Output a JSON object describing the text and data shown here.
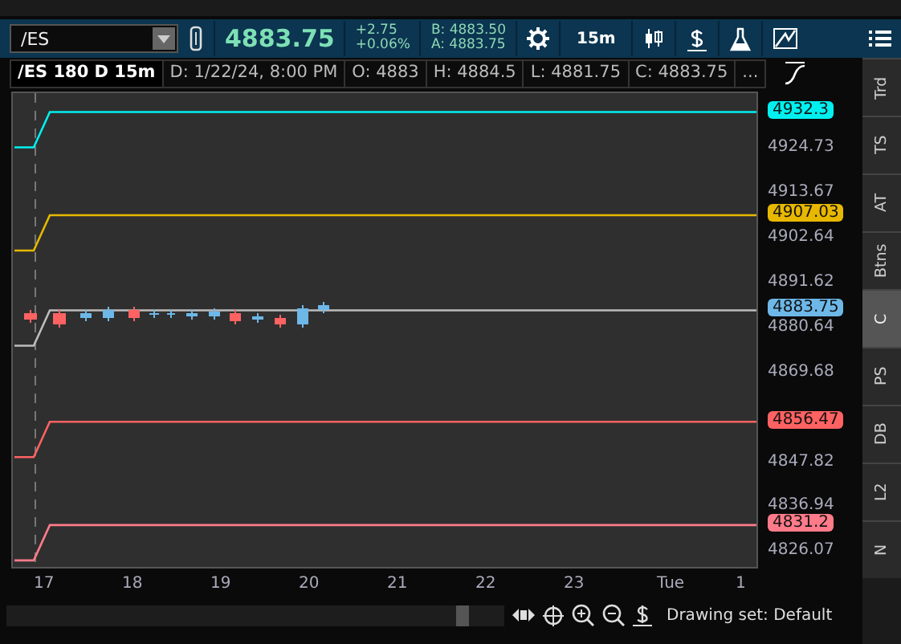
{
  "toolbar": {
    "symbol": "/ES",
    "last": "4883.75",
    "change": "+2.75",
    "change_pct": "+0.06%",
    "bid": "B: 4883.50",
    "ask": "A: 4883.75",
    "interval": "15m"
  },
  "info_bar": {
    "title": "/ES 180 D 15m",
    "cells": [
      "D: 1/22/24, 8:00 PM",
      "O: 4883",
      "H: 4884.5",
      "L: 4881.75",
      "C: 4883.75",
      "..."
    ]
  },
  "price_axis": {
    "ticks": [
      "4924.73",
      "4913.67",
      "4902.64",
      "4891.62",
      "4880.64",
      "4869.68",
      "4847.82",
      "4836.94",
      "4826.07"
    ]
  },
  "price_lines": [
    {
      "kind": "level",
      "label": "4932.3",
      "color": "#00f0f0"
    },
    {
      "kind": "level",
      "label": "4907.03",
      "color": "#e8b800"
    },
    {
      "kind": "last",
      "label": "4883.75",
      "color": "#6db8e8"
    },
    {
      "kind": "level",
      "label": "4856.47",
      "color": "#ff6262"
    },
    {
      "kind": "level",
      "label": "4831.2",
      "color": "#ff7b8a"
    }
  ],
  "time_axis": [
    "17",
    "18",
    "19",
    "20",
    "21",
    "22",
    "23",
    "Tue",
    "1"
  ],
  "status": {
    "drawing_set": "Drawing set: Default"
  },
  "side_tabs": [
    {
      "label": "Trd",
      "selected": false
    },
    {
      "label": "TS",
      "selected": false
    },
    {
      "label": "AT",
      "selected": false
    },
    {
      "label": "Btns",
      "selected": false
    },
    {
      "label": "C",
      "selected": true
    },
    {
      "label": "PS",
      "selected": false
    },
    {
      "label": "DB",
      "selected": false
    },
    {
      "label": "L2",
      "selected": false
    },
    {
      "label": "N",
      "selected": false
    }
  ]
}
